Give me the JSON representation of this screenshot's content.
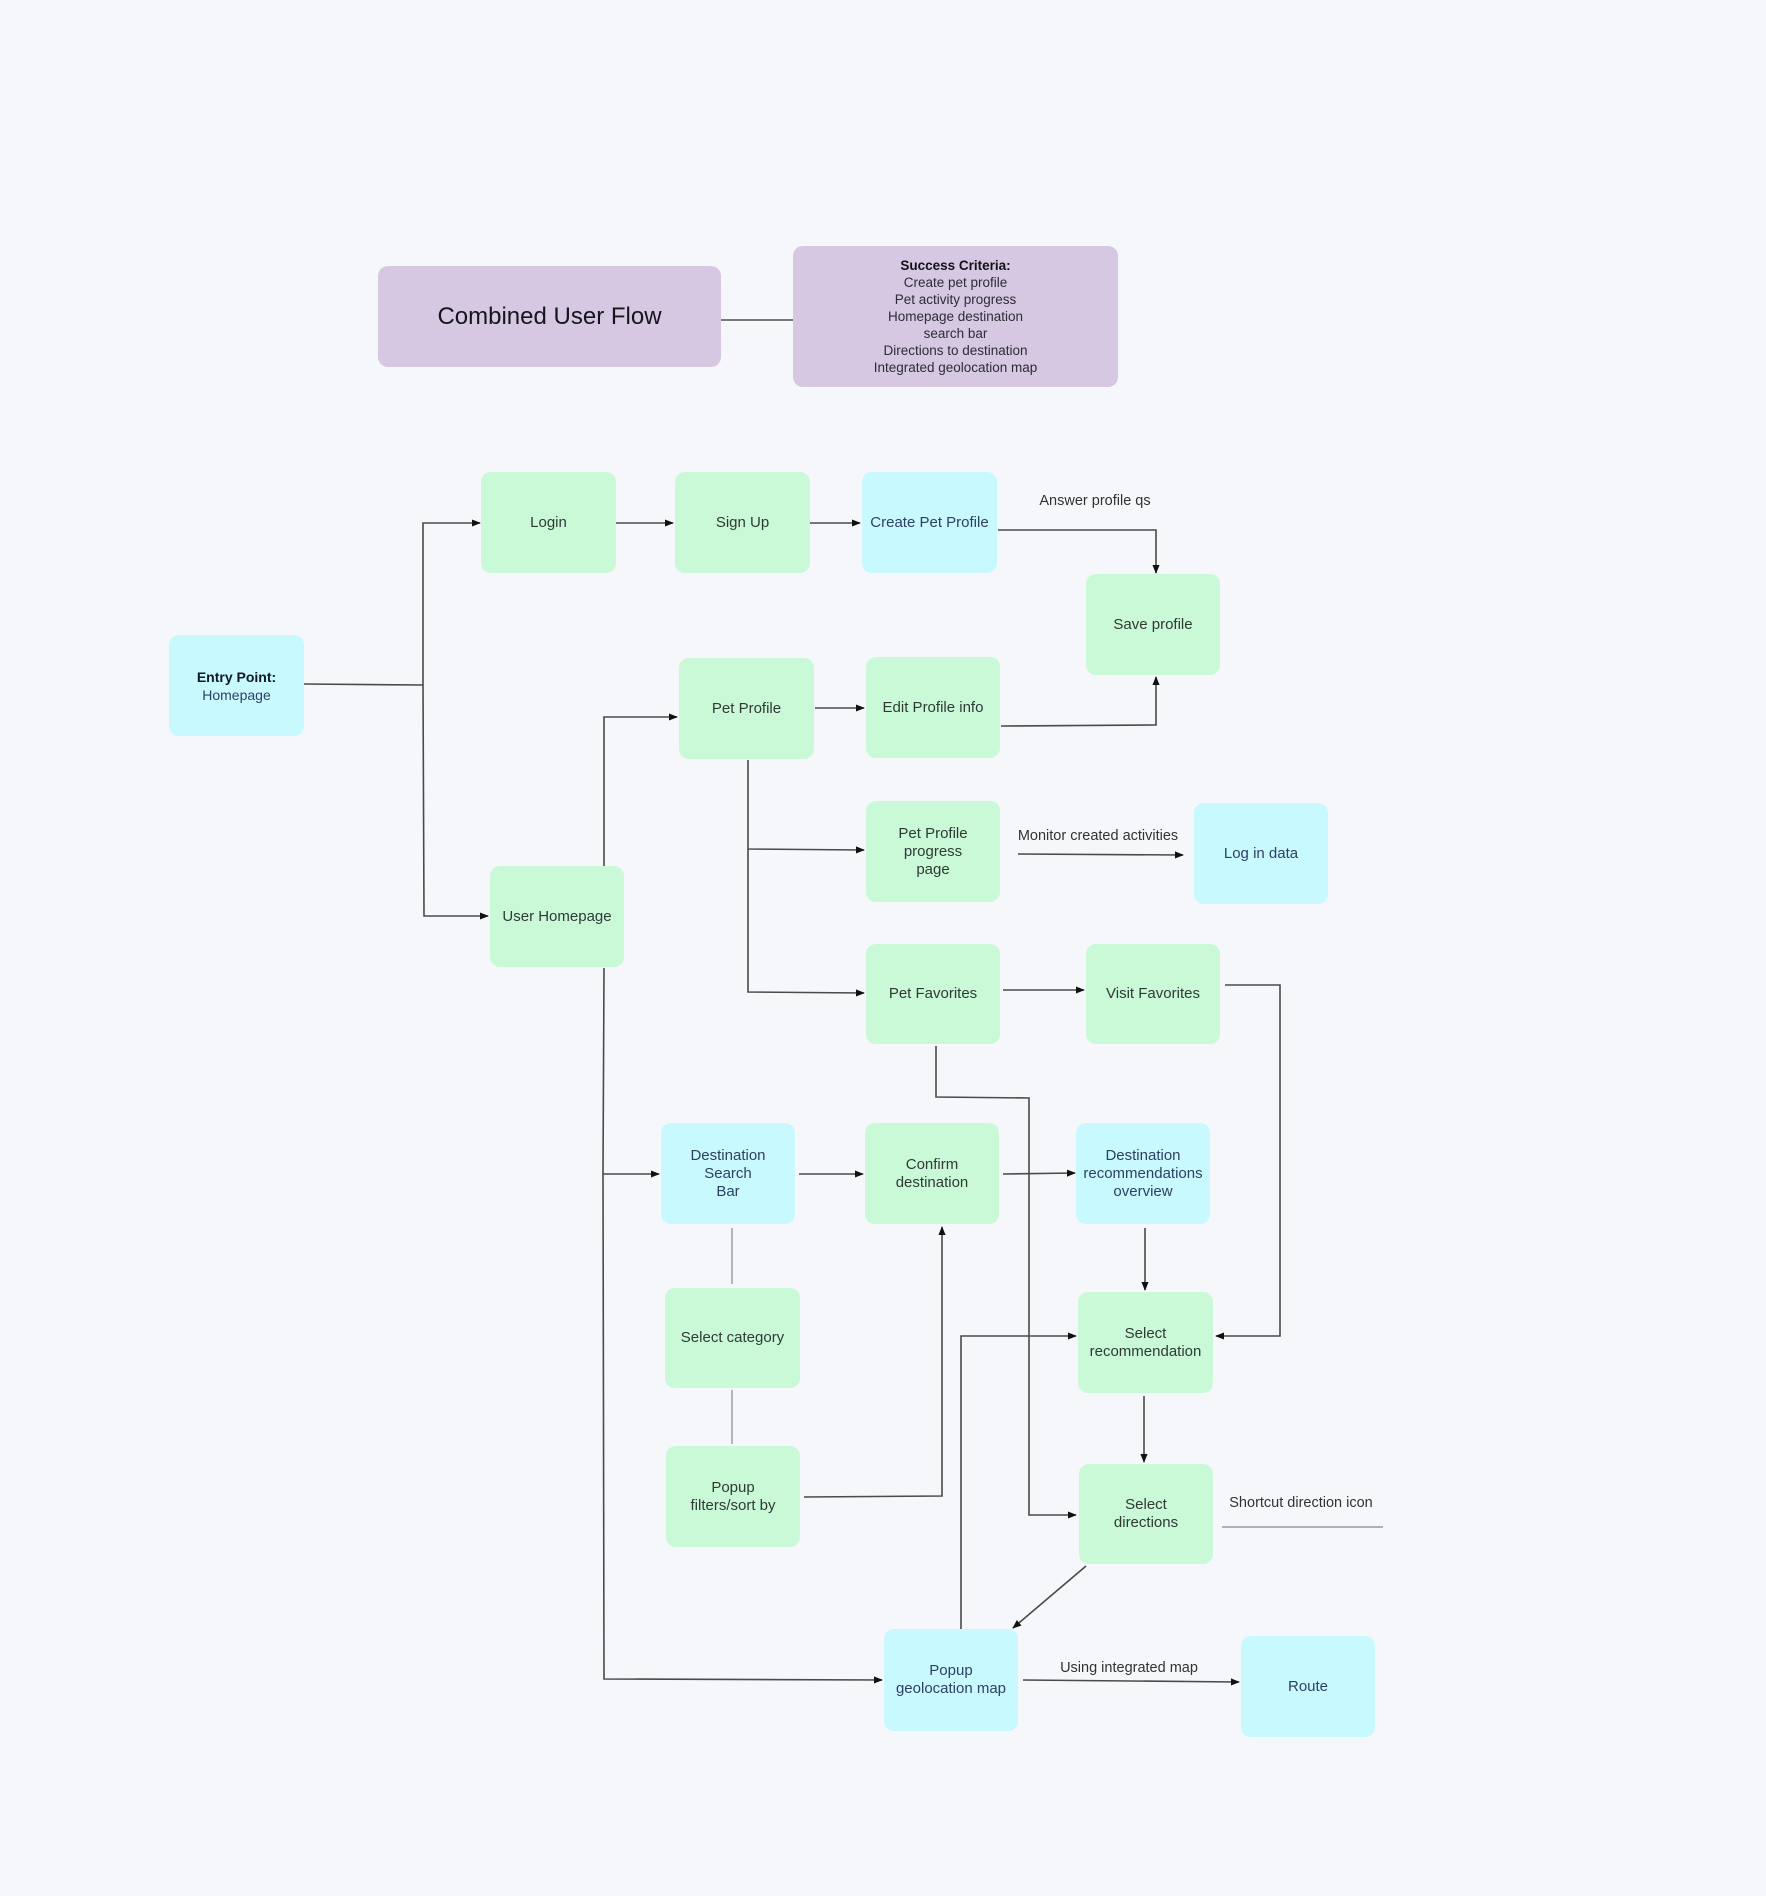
{
  "diagram": {
    "title": "Combined User Flow",
    "success_criteria": {
      "heading": "Success Criteria:",
      "items": [
        "Create pet profile",
        "Pet activity progress",
        "Homepage destination",
        "search bar",
        "Directions to destination",
        "Integrated geolocation map"
      ]
    },
    "entry_point": {
      "heading": "Entry Point:",
      "sub": "Homepage"
    },
    "nodes": {
      "login": "Login",
      "sign_up": "Sign Up",
      "create_pet_profile": "Create Pet Profile",
      "save_profile": "Save profile",
      "pet_profile": "Pet Profile",
      "edit_profile_info": "Edit Profile info",
      "user_homepage": "User Homepage",
      "pet_profile_progress": "Pet Profile progress\npage",
      "log_in_data": "Log in data",
      "pet_favorites": "Pet Favorites",
      "visit_favorites": "Visit Favorites",
      "destination_search_bar": "Destination Search\nBar",
      "confirm_destination": "Confirm\ndestination",
      "destination_recommendations": "Destination\nrecommendations\noverview",
      "select_category": "Select category",
      "select_recommendation": "Select\nrecommendation",
      "popup_filters": "Popup\nfilters/sort by",
      "select_directions": "Select\ndirections",
      "popup_geolocation_map": "Popup\ngeolocation map",
      "route": "Route"
    },
    "edge_labels": {
      "answer_profile_qs": "Answer profile qs",
      "monitor_created_activities": "Monitor created activities",
      "shortcut_direction_icon": "Shortcut direction icon",
      "using_integrated_map": "Using integrated map"
    },
    "colors": {
      "background": "#f5f7fb",
      "green_node": "#c9f9d6",
      "cyan_node": "#c7f9ff",
      "purple_node": "#d6c8e3",
      "connector": "#4a4a4a"
    }
  }
}
